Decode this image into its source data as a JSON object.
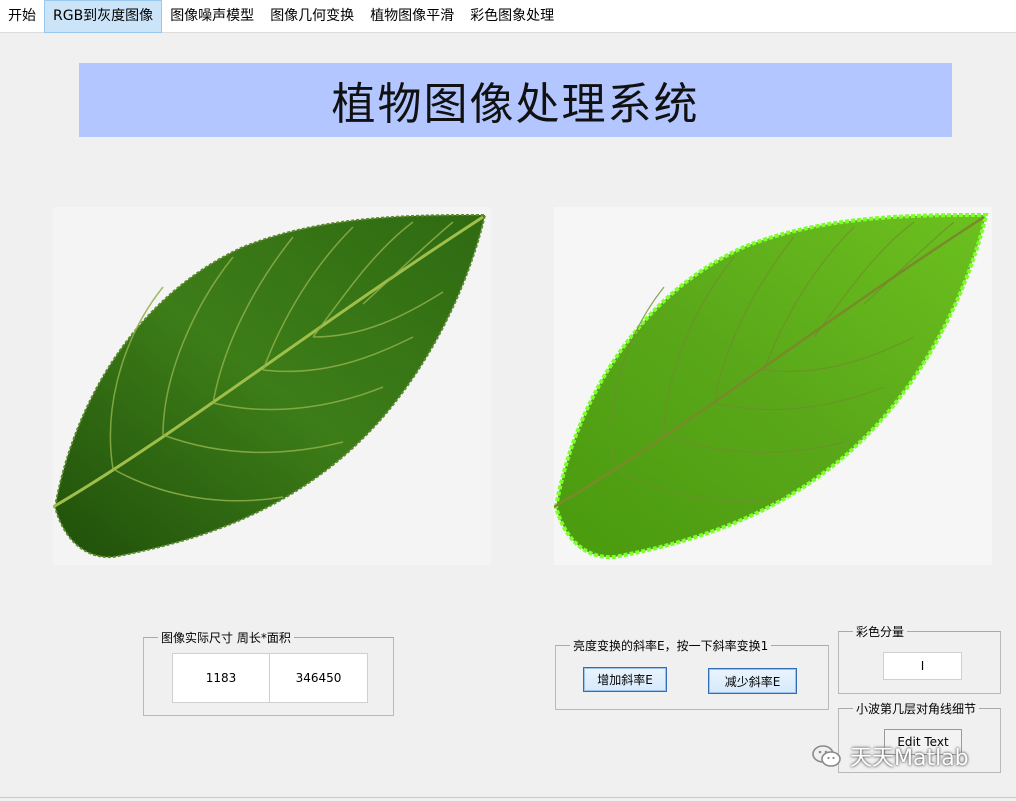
{
  "menu": {
    "items": [
      {
        "label": "开始"
      },
      {
        "label": "RGB到灰度图像"
      },
      {
        "label": "图像噪声模型"
      },
      {
        "label": "图像几何变换"
      },
      {
        "label": "植物图像平滑"
      },
      {
        "label": "彩色图象处理"
      }
    ],
    "active_index": 1
  },
  "banner": {
    "title": "植物图像处理系统",
    "color": "#b3c6ff"
  },
  "size_panel": {
    "legend": "图像实际尺寸 周长*面积",
    "perimeter": "1183",
    "area": "346450"
  },
  "slope_panel": {
    "legend": "亮度变换的斜率E，按一下斜率变换1",
    "increase_label": "增加斜率E",
    "decrease_label": "减少斜率E"
  },
  "color_panel": {
    "legend": "彩色分量",
    "value": "I"
  },
  "wavelet_panel": {
    "legend": "小波第几层对角线细节",
    "button_label": "Edit Text"
  },
  "watermark": {
    "text": "天天Matlab"
  },
  "colors": {
    "leaf_dark": "#2f6a12",
    "leaf_bright": "#5fc81a",
    "leaf_vein": "#a8c95a"
  }
}
